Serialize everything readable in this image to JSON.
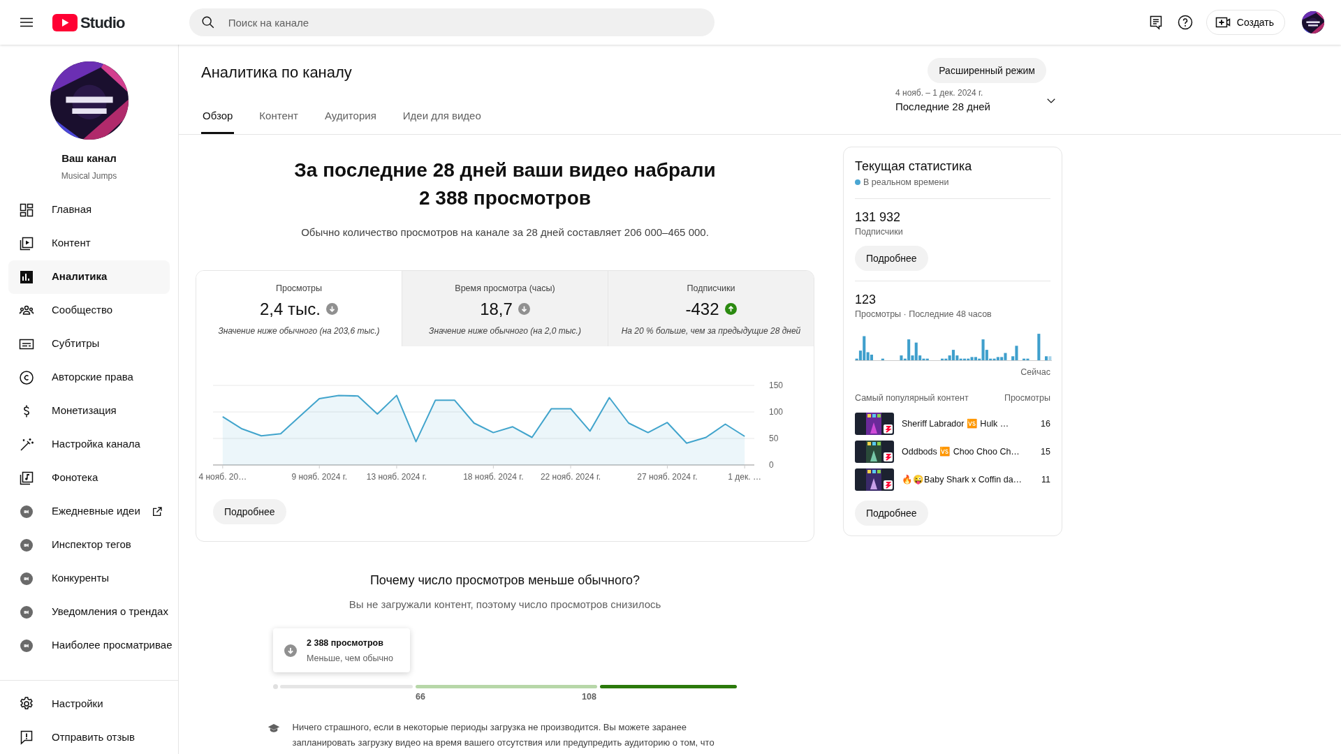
{
  "header": {
    "logo_text": "Studio",
    "search": {
      "placeholder": "Поиск на канале"
    },
    "create_button": "Создать"
  },
  "sidebar": {
    "channel_label": "Ваш канал",
    "channel_name": "Musical Jumps",
    "items": [
      {
        "label": "Главная",
        "kind": "dashboard",
        "selected": false
      },
      {
        "label": "Контент",
        "kind": "content",
        "selected": false
      },
      {
        "label": "Аналитика",
        "kind": "analytics",
        "selected": true
      },
      {
        "label": "Сообщество",
        "kind": "community",
        "selected": false
      },
      {
        "label": "Субтитры",
        "kind": "subtitles",
        "selected": false
      },
      {
        "label": "Авторские права",
        "kind": "copyright",
        "selected": false
      },
      {
        "label": "Монетизация",
        "kind": "monetization",
        "selected": false
      },
      {
        "label": "Настройка канала",
        "kind": "customization",
        "selected": false
      },
      {
        "label": "Фонотека",
        "kind": "audio",
        "selected": false
      },
      {
        "label": "Ежедневные идеи",
        "kind": "extension",
        "external": true,
        "selected": false
      },
      {
        "label": "Инспектор тегов",
        "kind": "extension",
        "external": false,
        "selected": false
      },
      {
        "label": "Конкуренты",
        "kind": "extension",
        "external": false,
        "selected": false
      },
      {
        "label": "Уведомления о трендах",
        "kind": "extension",
        "external": false,
        "selected": false
      },
      {
        "label": "Наиболее просматривае",
        "kind": "extension",
        "external": false,
        "selected": false
      }
    ],
    "footer_items": [
      {
        "label": "Настройки",
        "kind": "settings"
      },
      {
        "label": "Отправить отзыв",
        "kind": "feedback"
      }
    ]
  },
  "page": {
    "title": "Аналитика по каналу",
    "advanced_button": "Расширенный режим",
    "date_range": {
      "dates": "4 нояб. – 1 дек. 2024 г.",
      "period": "Последние 28 дней"
    },
    "tabs": [
      {
        "label": "Обзор",
        "selected": true
      },
      {
        "label": "Контент",
        "selected": false
      },
      {
        "label": "Аудитория",
        "selected": false
      },
      {
        "label": "Идеи для видео",
        "selected": false
      }
    ]
  },
  "summary": {
    "headline_lines": [
      "За последние 28 дней ваши видео набрали",
      "2 388 просмотров"
    ],
    "note": "Обычно количество просмотров на канале за 28 дней составляет 206 000–465 000."
  },
  "metrics": [
    {
      "label": "Просмотры",
      "value": "2,4 тыс.",
      "kind": "down",
      "note": "Значение ниже обычного (на 203,6 тыс.)",
      "selected": true
    },
    {
      "label": "Время просмотра (часы)",
      "value": "18,7",
      "kind": "down",
      "note": "Значение ниже обычного (на 2,0 тыс.)",
      "selected": false
    },
    {
      "label": "Подписчики",
      "value": "-432",
      "kind": "up",
      "note": "На 20 % больше, чем за предыдущие 28 дней",
      "selected": false
    }
  ],
  "chart_data": {
    "type": "area",
    "categories": [
      "4 нояб. 20…",
      null,
      null,
      null,
      null,
      "9 нояб. 2024 г.",
      null,
      null,
      null,
      "13 нояб. 2024 г.",
      null,
      null,
      null,
      null,
      "18 нояб. 2024 г.",
      null,
      null,
      null,
      "22 нояб. 2024 г.",
      null,
      null,
      null,
      null,
      "27 нояб. 2024 г.",
      null,
      null,
      null,
      "1 дек. …"
    ],
    "series": [
      {
        "color": "#41a4cc",
        "values": [
          91,
          68,
          55,
          59,
          92,
          125,
          131,
          130,
          96,
          131,
          44,
          122,
          122,
          79,
          61,
          72,
          52,
          106,
          106,
          64,
          127,
          79,
          61,
          80,
          41,
          52,
          77,
          54
        ]
      }
    ],
    "ylim": [
      0,
      150
    ],
    "yticks": [
      0,
      50,
      100,
      150
    ]
  },
  "more_button": "Подробнее",
  "why": {
    "title": "Почему число просмотров меньше обычного?",
    "subtitle": "Вы не загружали контент, поэтому число просмотров снизилось",
    "tooltip": {
      "title": "2 388 просмотров",
      "subtitle": "Меньше, чем обычно"
    },
    "range": {
      "segments": [
        {
          "color": "#e5e5e5"
        },
        {
          "color": "#b7d7a8"
        },
        {
          "color": "#2b7a0b"
        }
      ],
      "marks": [
        "66",
        "108"
      ]
    },
    "tip": "Ничего страшного, если в некоторые периоды загрузка не производится. Вы можете заранее запланировать загрузку видео на время вашего отсутствия или предупредить аудиторию о том, что"
  },
  "realtime": {
    "title": "Текущая статистика",
    "live_label": "В реальном времени",
    "subscribers": {
      "value": "131 932",
      "label": "Подписчики"
    },
    "subscribers_button": "Подробнее",
    "views": {
      "value": "123",
      "label": "Просмотры · Последние 48 часов"
    },
    "now_label": "Сейчас",
    "top_header": "Самый популярный контент",
    "views_header": "Просмотры",
    "top": [
      {
        "title": "Sheriff Labrador 🆚 Hulk …",
        "views": "16"
      },
      {
        "title": "Oddbods 🆚 Choo Choo Ch…",
        "views": "15"
      },
      {
        "title": "🔥😜Baby Shark x Coffin da…",
        "views": "11"
      }
    ],
    "button": "Подробнее"
  }
}
